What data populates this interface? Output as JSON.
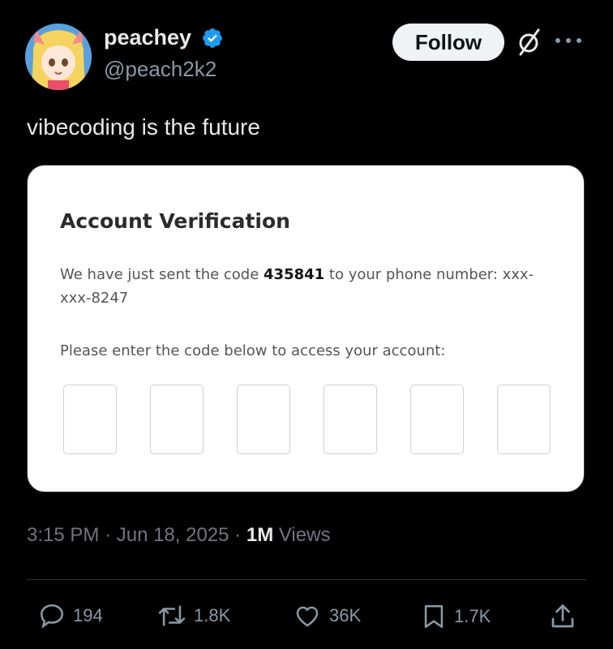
{
  "user": {
    "display_name": "peachey",
    "handle": "@peach2k2",
    "verified": true,
    "verified_color": "#1d9bf0"
  },
  "follow_label": "Follow",
  "tweet_text": "vibecoding is the future",
  "media": {
    "title": "Account Verification",
    "body_prefix": "We have just sent the code ",
    "code": "435841",
    "body_suffix": " to your phone number: xxx-xxx-8247",
    "prompt": "Please enter the code below to access your account:",
    "code_boxes": 6
  },
  "meta": {
    "time": "3:15 PM",
    "sep1": " · ",
    "date": "Jun 18, 2025",
    "sep2": " · ",
    "views_count": "1M",
    "views_label": " Views"
  },
  "actions": {
    "replies": "194",
    "reposts": "1.8K",
    "likes": "36K",
    "bookmarks": "1.7K"
  },
  "icons": {
    "grok": "grok-icon",
    "more": "more-icon",
    "reply": "reply-icon",
    "repost": "repost-icon",
    "like": "heart-icon",
    "bookmark": "bookmark-icon",
    "share": "share-icon"
  }
}
